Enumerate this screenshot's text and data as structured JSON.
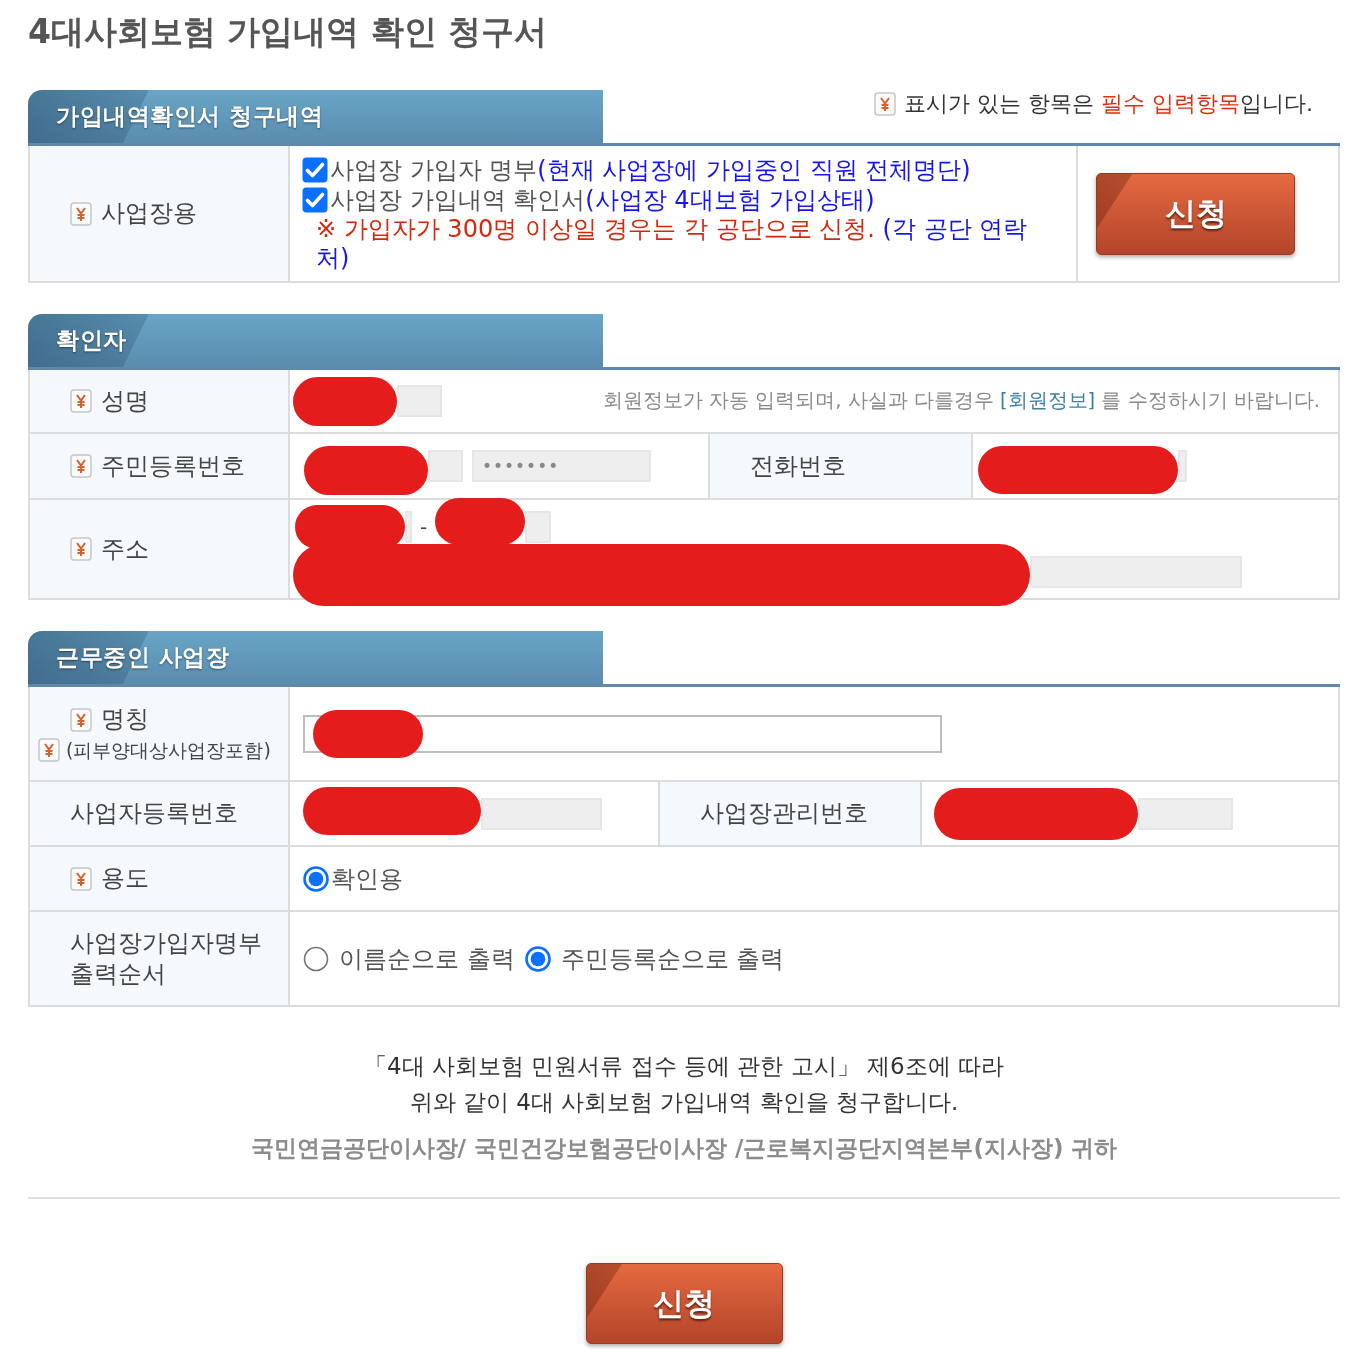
{
  "title": "4대사회보험 가입내역 확인 청구서",
  "request_section": {
    "heading": "가입내역확인서 청구내역",
    "required_note": {
      "before": "표시가 있는 항목은",
      "highlight": "필수 입력항목",
      "after": "입니다."
    },
    "label": {
      "text": "사업장용",
      "required": true
    },
    "options": [
      {
        "checked": true,
        "label": "사업장 가입자 명부",
        "detail": "(현재 사업장에 가입중인 직원 전체명단)"
      },
      {
        "checked": true,
        "label": "사업장 가입내역 확인서",
        "detail": "(사업장 4대보험 가입상태)"
      }
    ],
    "notice": {
      "warning": "※ 가입자가 300명 이상일 경우는 각 공단으로 신청.",
      "contact": "(각 공단 연락처)"
    },
    "button": "신청"
  },
  "applicant_section": {
    "heading": "확인자",
    "name": {
      "label": {
        "text": "성명",
        "required": true
      },
      "field": {
        "readonly": true,
        "redacted": true
      },
      "note": {
        "before": "회원정보가 자동 입력되며, 사실과 다를경우",
        "link": "[회원정보]",
        "after": "를 수정하시기 바랍니다."
      }
    },
    "resident_number": {
      "label": {
        "text": "주민등록번호",
        "required": true
      },
      "fields": [
        {
          "readonly": true,
          "redacted": true
        },
        {
          "readonly": true,
          "redacted": false,
          "value": "•••••••"
        }
      ]
    },
    "phone": {
      "label": {
        "text": "전화번호",
        "required": false
      },
      "field": {
        "readonly": true,
        "redacted": true
      }
    },
    "address": {
      "label": {
        "text": "주소",
        "required": true
      },
      "postcode": [
        {
          "readonly": true,
          "redacted": true
        },
        {
          "readonly": true,
          "redacted": true
        }
      ],
      "separator": "-",
      "street": {
        "readonly": true,
        "redacted": true
      }
    }
  },
  "workplace_section": {
    "heading": "근무중인 사업장",
    "name": {
      "label": {
        "text": "명칭",
        "required": true
      },
      "sublabel": {
        "text": "(피부양대상사업장포함)",
        "required": true
      },
      "field": {
        "readonly": false,
        "redacted": true
      }
    },
    "registration_number": {
      "label": {
        "text": "사업자등록번호",
        "required": false
      },
      "field": {
        "readonly": true,
        "redacted": true
      }
    },
    "management_number": {
      "label": {
        "text": "사업장관리번호",
        "required": false
      },
      "field": {
        "readonly": true,
        "redacted": true
      }
    },
    "purpose": {
      "label": {
        "text": "용도",
        "required": true
      },
      "options": [
        {
          "label": "확인용",
          "selected": true
        }
      ]
    },
    "print_order": {
      "label": {
        "text": "사업장가입자명부 출력순서",
        "required": false
      },
      "options": [
        {
          "label": "이름순으로 출력",
          "selected": false
        },
        {
          "label": "주민등록순으로 출력",
          "selected": true
        }
      ]
    }
  },
  "declaration": [
    "「4대 사회보험 민원서류 접수 등에 관한 고시」 제6조에 따라",
    "위와 같이 4대 사회보험 가입내역 확인을 청구합니다."
  ],
  "addressee": "국민연금공단이사장/ 국민건강보험공단이사장 /근로복지공단지역본부(지사장) 귀하",
  "submit_button": "신청"
}
